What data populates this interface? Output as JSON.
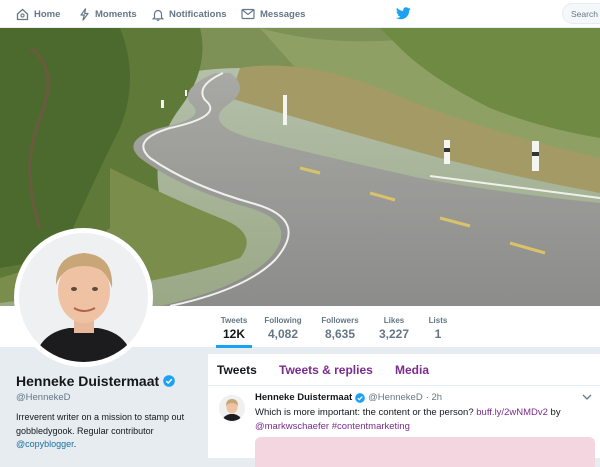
{
  "nav": {
    "home": "Home",
    "moments": "Moments",
    "notifications": "Notifications",
    "messages": "Messages",
    "search_placeholder": "Search Tw"
  },
  "stats": [
    {
      "label": "Tweets",
      "value": "12K"
    },
    {
      "label": "Following",
      "value": "4,082"
    },
    {
      "label": "Followers",
      "value": "8,635"
    },
    {
      "label": "Likes",
      "value": "3,227"
    },
    {
      "label": "Lists",
      "value": "1"
    }
  ],
  "profile": {
    "name": "Henneke Duistermaat",
    "handle": "@HennekeD",
    "bio_text": "Irreverent writer on a mission to stamp out gobbledygook. Regular contributor ",
    "bio_link": "@copyblogger",
    "bio_end": "."
  },
  "tabs": {
    "tweets": "Tweets",
    "replies": "Tweets & replies",
    "media": "Media"
  },
  "tweet": {
    "name": "Henneke Duistermaat",
    "handle": "@HennekeD",
    "time": "· 2h",
    "text": "Which is more important: the content or the person? ",
    "link": "buff.ly/2wNMDv2",
    "by": " by",
    "mention": "@markwschaefer",
    "hashtag": "#contentmarketing"
  },
  "colors": {
    "twitter_blue": "#1da1f2",
    "link_purple": "#7a2c8c",
    "muted": "#657786"
  }
}
